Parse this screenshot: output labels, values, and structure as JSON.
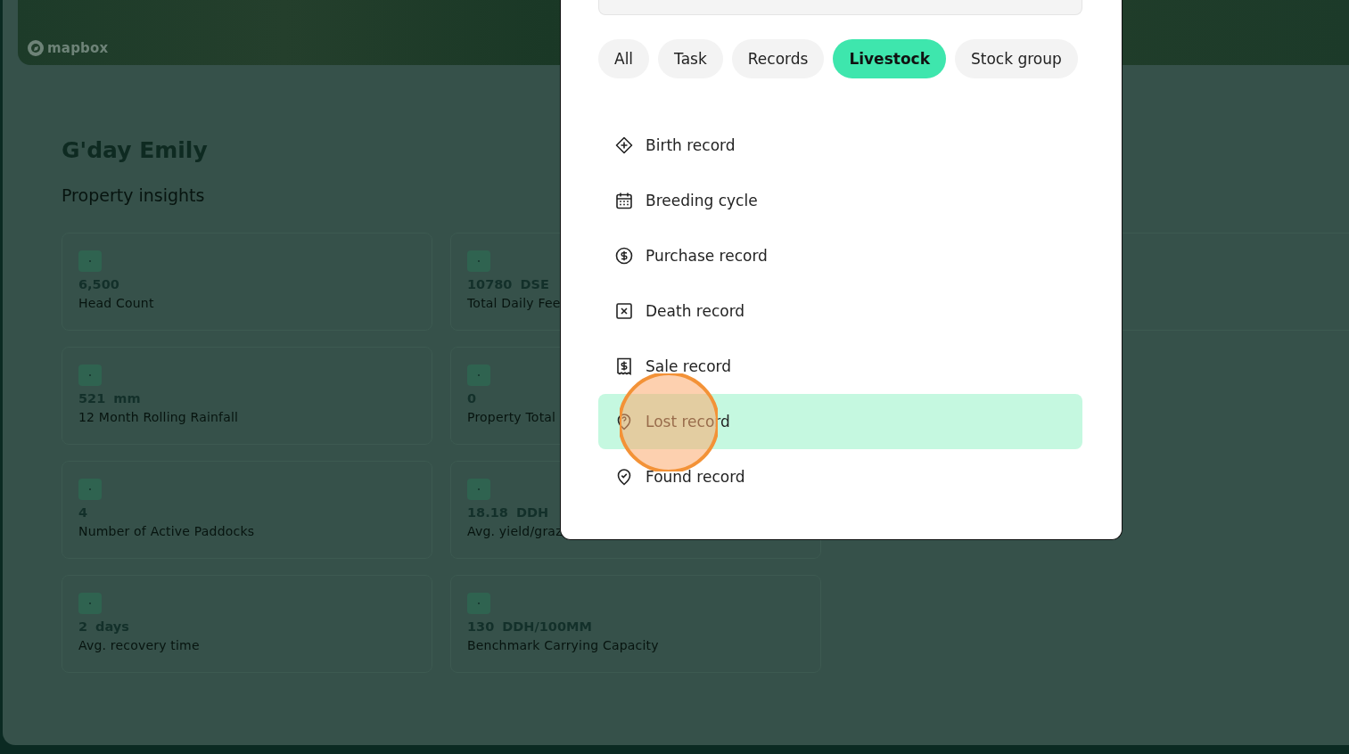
{
  "map": {
    "attribution": "mapbox"
  },
  "greeting": "G'day Emily",
  "section_title": "Property insights",
  "stats": [
    {
      "value": "6,500",
      "label": "Head Count"
    },
    {
      "value": "10780",
      "unit": "DSE",
      "label": "Total Daily Fee"
    },
    {
      "value": "521",
      "unit": "mm",
      "label": "12 Month Rolling Rainfall"
    },
    {
      "value": "0",
      "label": "Property Total"
    },
    {
      "value": "4",
      "label": "Number of Active Paddocks"
    },
    {
      "value": "18.18",
      "unit": "DDH",
      "label": "Avg. yield/graz"
    },
    {
      "value": "2",
      "unit": "days",
      "label": "Avg. recovery time"
    },
    {
      "value": "130",
      "unit": "DDH/100MM",
      "label": "Benchmark Carrying Capacity"
    }
  ],
  "filter_chips": [
    {
      "label": "All",
      "selected": false
    },
    {
      "label": "Task",
      "selected": false
    },
    {
      "label": "Records",
      "selected": false
    },
    {
      "label": "Livestock",
      "selected": true
    },
    {
      "label": "Stock group",
      "selected": false
    }
  ],
  "menu_items": [
    {
      "label": "Birth record",
      "selected": false
    },
    {
      "label": "Breeding cycle",
      "selected": false
    },
    {
      "label": "Purchase record",
      "selected": false
    },
    {
      "label": "Death record",
      "selected": false
    },
    {
      "label": "Sale record",
      "selected": false
    },
    {
      "label": "Lost record",
      "selected": true
    },
    {
      "label": "Found record",
      "selected": false
    }
  ]
}
